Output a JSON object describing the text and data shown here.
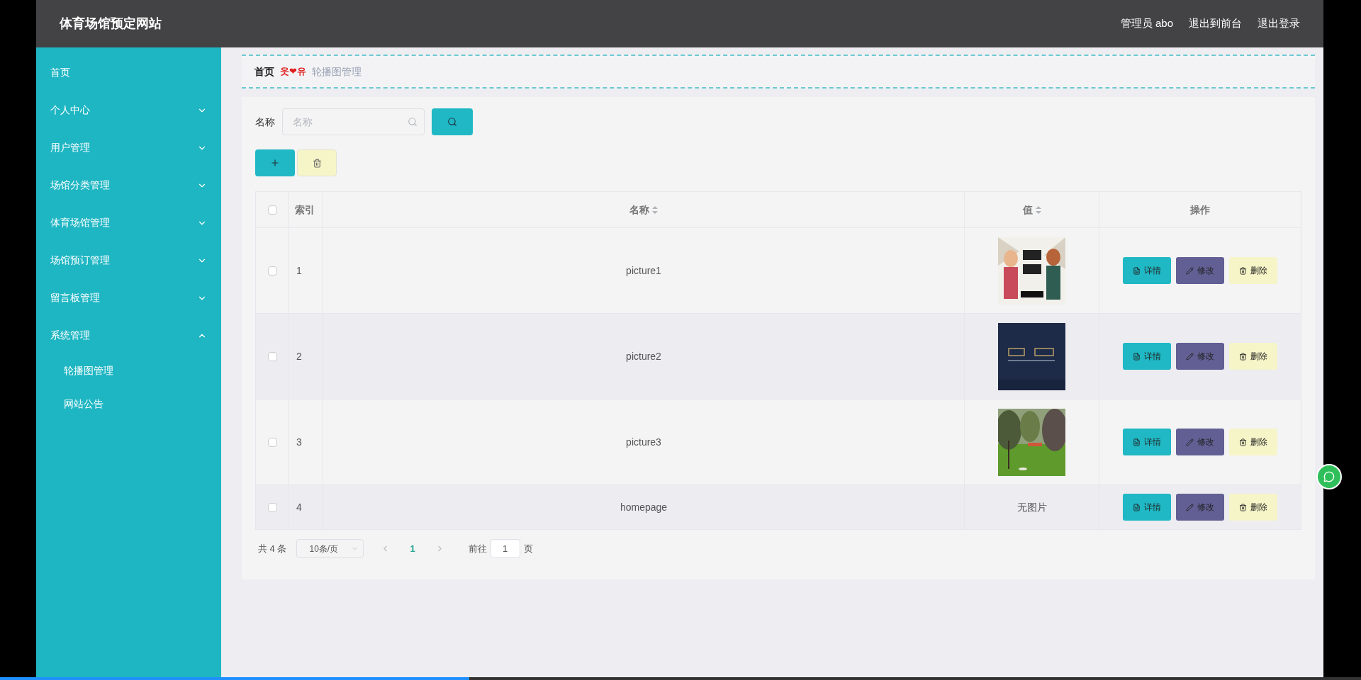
{
  "header": {
    "title": "体育场馆预定网站",
    "links": [
      "管理员 abo",
      "退出到前台",
      "退出登录"
    ]
  },
  "sidebar": {
    "items": [
      {
        "label": "首页"
      },
      {
        "label": "个人中心",
        "expanded": false
      },
      {
        "label": "用户管理",
        "expanded": false
      },
      {
        "label": "场馆分类管理",
        "expanded": false
      },
      {
        "label": "体育场馆管理",
        "expanded": false
      },
      {
        "label": "场馆预订管理",
        "expanded": false
      },
      {
        "label": "留言板管理",
        "expanded": false
      },
      {
        "label": "系统管理",
        "expanded": true,
        "children": [
          {
            "label": "轮播图管理"
          },
          {
            "label": "网站公告"
          }
        ]
      }
    ]
  },
  "breadcrumb": {
    "home": "首页",
    "separator": "웃❤유",
    "current": "轮播图管理"
  },
  "search": {
    "label": "名称",
    "placeholder": "名称"
  },
  "table": {
    "all_checked": false,
    "columns": [
      {
        "label": "索引",
        "sortable": false
      },
      {
        "label": "名称",
        "sortable": true
      },
      {
        "label": "值",
        "sortable": true
      },
      {
        "label": "操作",
        "sortable": false
      }
    ],
    "rows": [
      {
        "checked": false,
        "index": "1",
        "name": "picture1",
        "value": {
          "kind": "picture"
        },
        "actions": [
          "详情",
          "修改",
          "删除"
        ]
      },
      {
        "checked": false,
        "index": "2",
        "name": "picture2",
        "value": {
          "kind": "picture"
        },
        "actions": [
          "详情",
          "修改",
          "删除"
        ]
      },
      {
        "checked": false,
        "index": "3",
        "name": "picture3",
        "value": {
          "kind": "picture"
        },
        "actions": [
          "详情",
          "修改",
          "删除"
        ]
      },
      {
        "checked": false,
        "index": "4",
        "name": "homepage",
        "value": {
          "kind": "text",
          "text": "无图片"
        },
        "actions": [
          "详情",
          "修改",
          "删除"
        ]
      }
    ]
  },
  "pagination": {
    "total": "共 4 条",
    "page_size": "10条/页",
    "pages": [
      {
        "label": "1",
        "selected": true
      }
    ],
    "goto_label": "前往",
    "goto_value": "1",
    "goto_suffix": "页"
  },
  "video_progress": {
    "level": 0.345
  }
}
